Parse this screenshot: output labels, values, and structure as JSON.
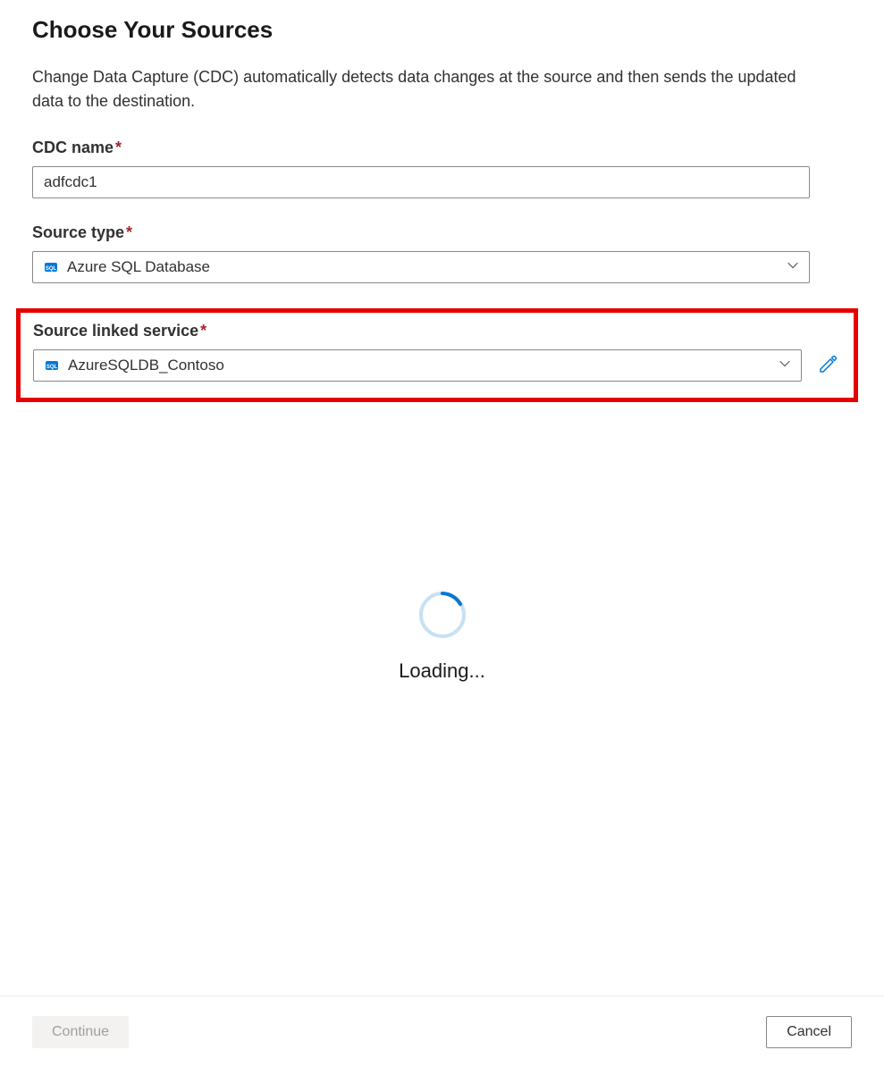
{
  "header": {
    "title": "Choose Your Sources",
    "description": "Change Data Capture (CDC) automatically detects data changes at the source and then sends the updated data to the destination."
  },
  "fields": {
    "cdc_name": {
      "label": "CDC name",
      "value": "adfcdc1"
    },
    "source_type": {
      "label": "Source type",
      "value": "Azure SQL Database"
    },
    "source_linked_service": {
      "label": "Source linked service",
      "value": "AzureSQLDB_Contoso"
    }
  },
  "loading": {
    "text": "Loading..."
  },
  "footer": {
    "continue_label": "Continue",
    "cancel_label": "Cancel"
  },
  "colors": {
    "accent": "#0078d4",
    "highlight": "#e60000",
    "required": "#a4262c"
  }
}
